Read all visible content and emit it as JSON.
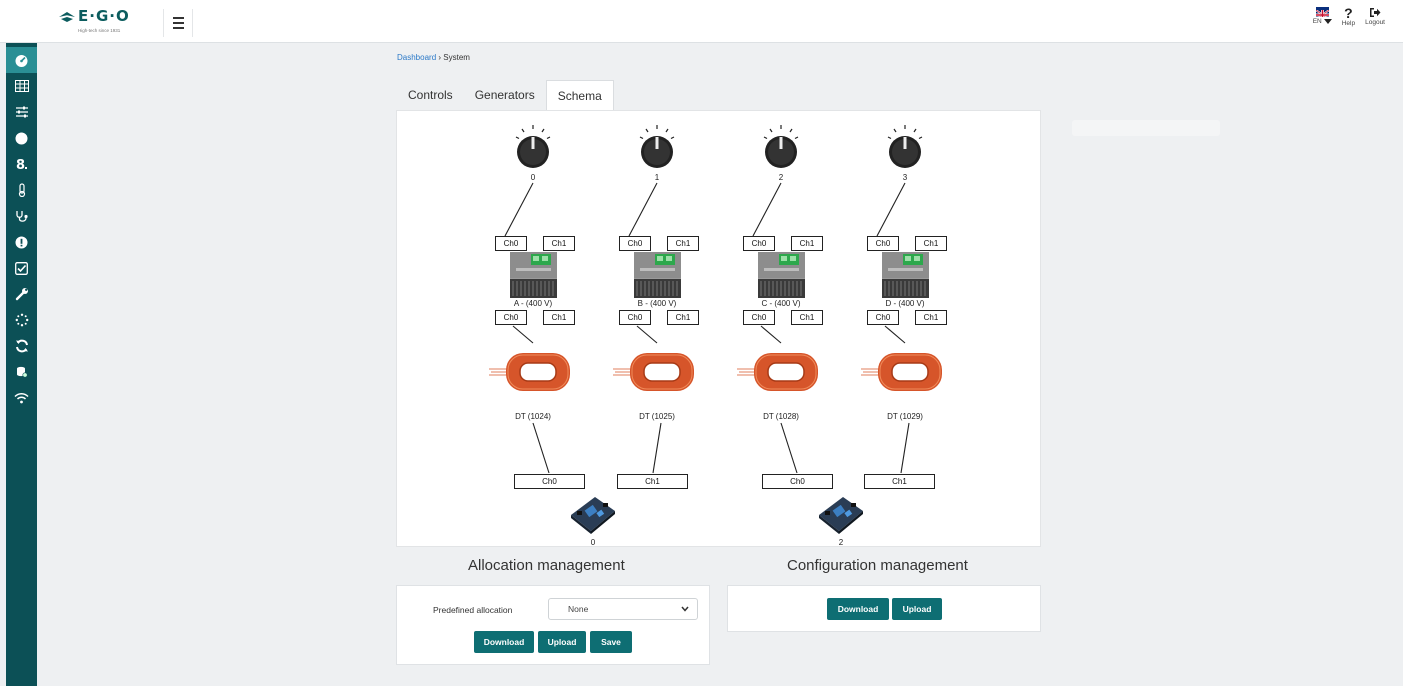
{
  "header": {
    "brand": "E·G·O",
    "tagline": "High-tech since 1931",
    "language": "EN",
    "help_label": "Help",
    "logout_label": "Logout"
  },
  "sidebar": {
    "items": [
      {
        "icon": "dashboard-gauge-icon",
        "active": true
      },
      {
        "icon": "table-grid-icon"
      },
      {
        "icon": "sliders-icon"
      },
      {
        "icon": "circle-icon"
      },
      {
        "icon": "digit-eight-icon"
      },
      {
        "icon": "thermometer-icon"
      },
      {
        "icon": "stethoscope-icon"
      },
      {
        "icon": "alert-icon"
      },
      {
        "icon": "checkbox-icon"
      },
      {
        "icon": "wrench-icon"
      },
      {
        "icon": "spinner-icon"
      },
      {
        "icon": "sync-icon"
      },
      {
        "icon": "database-icon"
      },
      {
        "icon": "wifi-icon"
      }
    ]
  },
  "breadcrumb": {
    "root": "Dashboard",
    "separator": "›",
    "current": "System"
  },
  "tabs": [
    {
      "label": "Controls"
    },
    {
      "label": "Generators"
    },
    {
      "label": "Schema",
      "active": true
    }
  ],
  "schema": {
    "columns": [
      {
        "knob": "0",
        "generator": "A - (400 V)",
        "coil": "DT (1024)"
      },
      {
        "knob": "1",
        "generator": "B - (400 V)",
        "coil": "DT (1025)"
      },
      {
        "knob": "2",
        "generator": "C - (400 V)",
        "coil": "DT (1028)"
      },
      {
        "knob": "3",
        "generator": "D - (400 V)",
        "coil": "DT (1029)"
      }
    ],
    "ch0": "Ch0",
    "ch1": "Ch1",
    "boards": [
      {
        "label": "0",
        "ch_left": "Ch0",
        "ch_right": "Ch1"
      },
      {
        "label": "2",
        "ch_left": "Ch0",
        "ch_right": "Ch1"
      }
    ]
  },
  "allocation": {
    "title": "Allocation management",
    "field_label": "Predefined allocation",
    "selected": "None",
    "download": "Download",
    "upload": "Upload",
    "save": "Save"
  },
  "configuration": {
    "title": "Configuration management",
    "download": "Download",
    "upload": "Upload"
  },
  "colors": {
    "sidebar": "#0c5056",
    "sidebar_active": "#2a8f95",
    "button": "#0e6e73",
    "link": "#2b79c8",
    "coil": "#d6552a"
  }
}
